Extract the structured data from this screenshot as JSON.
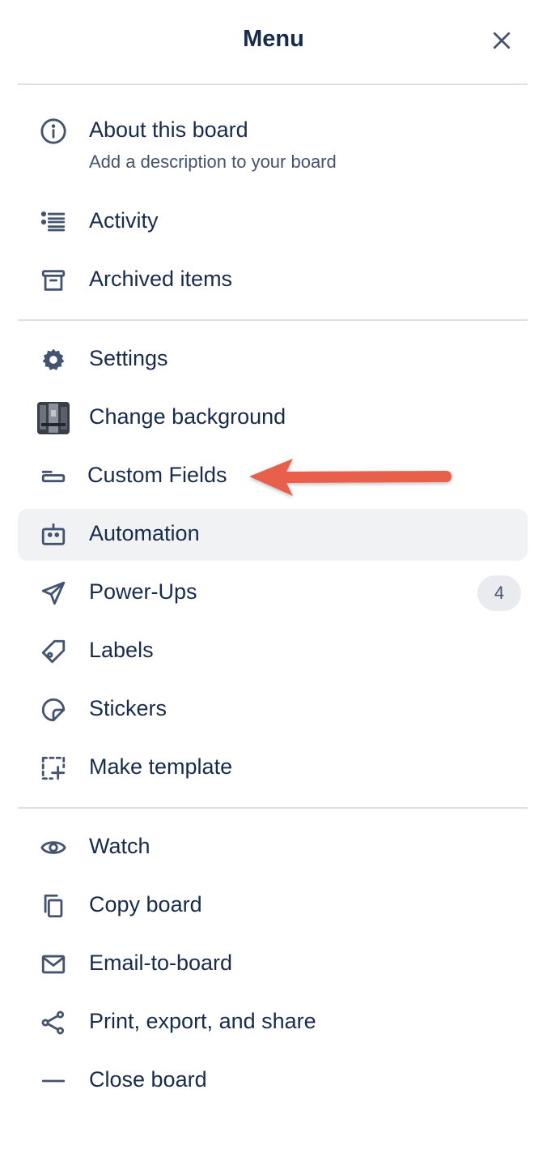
{
  "menu": {
    "title": "Menu",
    "close_icon": "close-icon"
  },
  "sections": [
    [
      {
        "label": "About this board",
        "sublabel": "Add a description to your board",
        "icon": "info-icon"
      },
      {
        "label": "Activity",
        "icon": "activity-list-icon"
      },
      {
        "label": "Archived items",
        "icon": "archive-box-icon"
      }
    ],
    [
      {
        "label": "Settings",
        "icon": "gear-icon"
      },
      {
        "label": "Change background",
        "icon": "background-thumbnail"
      },
      {
        "label": "Custom Fields",
        "icon": "custom-field-icon"
      },
      {
        "label": "Automation",
        "icon": "robot-icon",
        "highlighted": true
      },
      {
        "label": "Power-Ups",
        "icon": "rocket-icon",
        "badge": "4"
      },
      {
        "label": "Labels",
        "icon": "tag-icon"
      },
      {
        "label": "Stickers",
        "icon": "sticker-icon"
      },
      {
        "label": "Make template",
        "icon": "template-add-icon"
      }
    ],
    [
      {
        "label": "Watch",
        "icon": "eye-icon"
      },
      {
        "label": "Copy board",
        "icon": "copy-icon"
      },
      {
        "label": "Email-to-board",
        "icon": "mail-icon"
      },
      {
        "label": "Print, export, and share",
        "icon": "share-icon"
      },
      {
        "label": "Close board",
        "icon": "minus-icon"
      }
    ]
  ],
  "annotation": {
    "type": "arrow",
    "color": "#e8604c",
    "points_to": "Custom Fields"
  }
}
